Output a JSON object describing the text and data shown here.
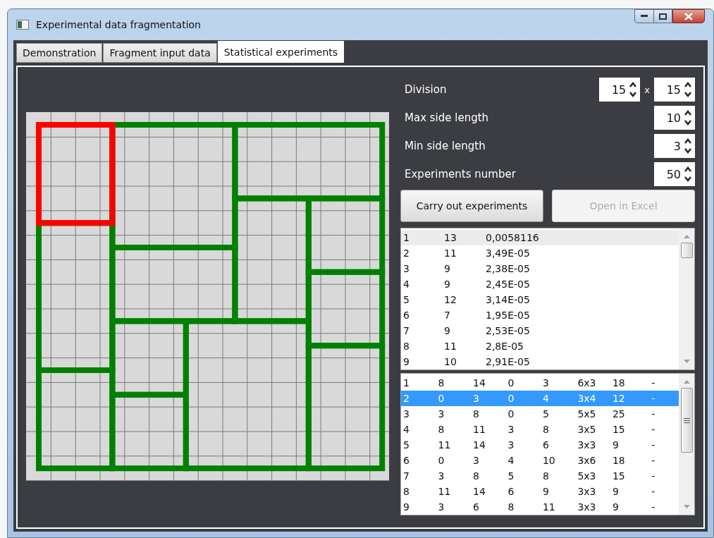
{
  "window": {
    "title": "Experimental data fragmentation"
  },
  "tabs": [
    {
      "label": "Demonstration",
      "selected": false
    },
    {
      "label": "Fragment input data",
      "selected": false
    },
    {
      "label": "Statistical experiments",
      "selected": true
    }
  ],
  "parameters": [
    {
      "label": "Division",
      "values": [
        "15",
        "15"
      ],
      "separator": "x"
    },
    {
      "label": "Max side length",
      "values": [
        "10"
      ]
    },
    {
      "label": "Min side length",
      "values": [
        "3"
      ]
    },
    {
      "label": "Experiments number",
      "values": [
        "50"
      ]
    }
  ],
  "buttons": [
    {
      "label": "Carry out experiments",
      "disabled": false
    },
    {
      "label": "Open in Excel",
      "disabled": true
    }
  ],
  "experiments_list": {
    "focused": false,
    "rows": [
      {
        "cells": [
          "1",
          "13",
          "0,0058116"
        ],
        "selected": true
      },
      {
        "cells": [
          "2",
          "11",
          "3,49E-05"
        ],
        "selected": false
      },
      {
        "cells": [
          "3",
          "9",
          "2,38E-05"
        ],
        "selected": false
      },
      {
        "cells": [
          "4",
          "9",
          "2,45E-05"
        ],
        "selected": false
      },
      {
        "cells": [
          "5",
          "12",
          "3,14E-05"
        ],
        "selected": false
      },
      {
        "cells": [
          "6",
          "7",
          "1,95E-05"
        ],
        "selected": false
      },
      {
        "cells": [
          "7",
          "9",
          "2,53E-05"
        ],
        "selected": false
      },
      {
        "cells": [
          "8",
          "11",
          "2,8E-05"
        ],
        "selected": false
      },
      {
        "cells": [
          "9",
          "10",
          "2,91E-05"
        ],
        "selected": false
      }
    ]
  },
  "fragments_list": {
    "focused": true,
    "rows": [
      {
        "cells": [
          "1",
          "8",
          "14",
          "0",
          "3",
          "6x3",
          "18",
          "-"
        ],
        "selected": false
      },
      {
        "cells": [
          "2",
          "0",
          "3",
          "0",
          "4",
          "3x4",
          "12",
          "-"
        ],
        "selected": true
      },
      {
        "cells": [
          "3",
          "3",
          "8",
          "0",
          "5",
          "5x5",
          "25",
          "-"
        ],
        "selected": false
      },
      {
        "cells": [
          "4",
          "8",
          "11",
          "3",
          "8",
          "3x5",
          "15",
          "-"
        ],
        "selected": false
      },
      {
        "cells": [
          "5",
          "11",
          "14",
          "3",
          "6",
          "3x3",
          "9",
          "-"
        ],
        "selected": false
      },
      {
        "cells": [
          "6",
          "0",
          "3",
          "4",
          "10",
          "3x6",
          "18",
          "-"
        ],
        "selected": false
      },
      {
        "cells": [
          "7",
          "3",
          "8",
          "5",
          "8",
          "5x3",
          "15",
          "-"
        ],
        "selected": false
      },
      {
        "cells": [
          "8",
          "11",
          "14",
          "6",
          "9",
          "3x3",
          "9",
          "-"
        ],
        "selected": false
      },
      {
        "cells": [
          "9",
          "3",
          "6",
          "8",
          "11",
          "3x3",
          "9",
          "-"
        ],
        "selected": false
      }
    ]
  }
}
